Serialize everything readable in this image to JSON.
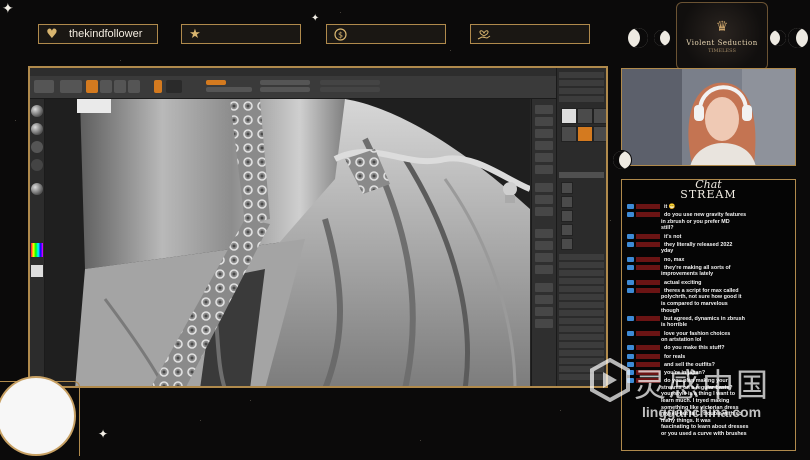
{
  "widgets": {
    "follower": {
      "icon": "heart-icon",
      "label": "thekindfollower"
    },
    "subscriber": {
      "icon": "star-icon",
      "label": ""
    },
    "donation": {
      "icon": "dollar-icon",
      "label": ""
    },
    "cheer": {
      "icon": "hand-heart-icon",
      "label": ""
    }
  },
  "logo": {
    "line1": "Violent Seduction",
    "line2": "TIMELESS"
  },
  "colors": {
    "gold_border": "#b08a4c",
    "accent_orange": "#d47a1f",
    "chat_user": "#b32222",
    "sub_badge": "#3d8ad6"
  },
  "chat": {
    "title_script": "Chat",
    "title_main": "STREAM",
    "messages": [
      {
        "user": "",
        "text": "it 😁"
      },
      {
        "user": "",
        "text": "do you use new gravity features",
        "cont": [
          "in zbrush or you prefer MD",
          "still?"
        ]
      },
      {
        "user": "",
        "text": "it's not"
      },
      {
        "user": "",
        "text": "they literally released 2022",
        "cont": [
          "yday"
        ]
      },
      {
        "user": "",
        "text": "no, max"
      },
      {
        "user": "",
        "text": "they're making all sorts of",
        "cont": [
          "improvements lately"
        ]
      },
      {
        "user": "",
        "text": "actual exciting"
      },
      {
        "user": "",
        "text": "theres a script for max called",
        "cont": [
          "polychrth, not sure how good it",
          "is compared to marvelous",
          "though"
        ]
      },
      {
        "user": "",
        "text": "but agreed, dynamics in zbrush",
        "cont": [
          "is horrible"
        ]
      },
      {
        "user": "",
        "text": "love your fashion choices",
        "cont": [
          "on artstation lol"
        ]
      },
      {
        "user": "",
        "text": "do you make this stuff?"
      },
      {
        "user": "",
        "text": "for reals"
      },
      {
        "user": "",
        "text": "and sell the outfits?"
      },
      {
        "user": "",
        "text": "you're in japan?"
      },
      {
        "user": "",
        "text": "do you plan making your",
        "cont": [
          "streams on a regular basis?",
          "your style is a thing I want to",
          "learn much. I tryed making",
          "something like victorian dress",
          "myself but fail... trouble with so",
          "many things. It was",
          "fascinating to learn about dresses",
          "or you used a curve with brushes"
        ]
      }
    ]
  },
  "watermark": {
    "cn": "灵感中国",
    "url": "lingganchina.com"
  }
}
